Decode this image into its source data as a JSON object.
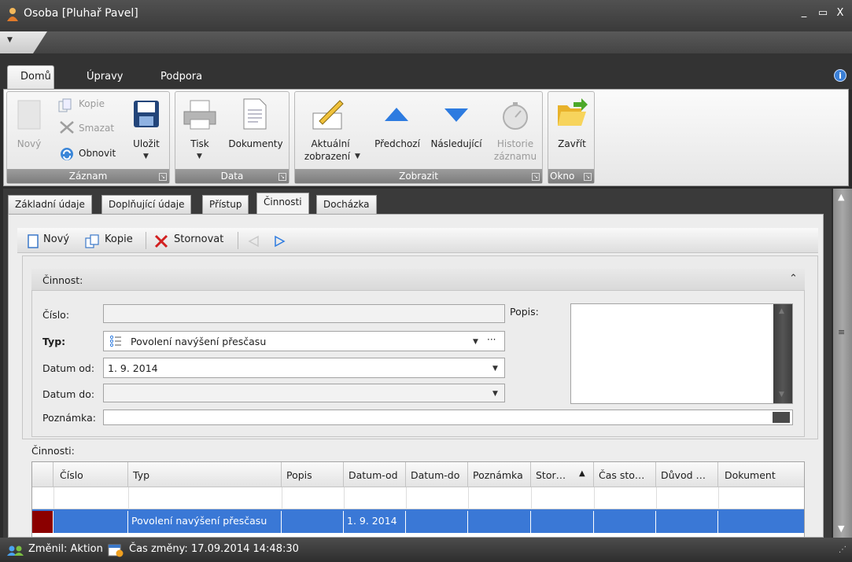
{
  "window": {
    "title": "Osoba [Pluhař Pavel]",
    "minimize": "_",
    "maximize": "▭",
    "close": "X"
  },
  "ribbon_tabs": [
    "Domů",
    "Úpravy",
    "Podpora"
  ],
  "ribbon": {
    "zaznam": {
      "label": "Záznam",
      "novy": "Nový",
      "kopie": "Kopie",
      "smazat": "Smazat",
      "obnovit": "Obnovit",
      "ulozit": "Uložit"
    },
    "data": {
      "label": "Data",
      "tisk": "Tisk",
      "dokumenty": "Dokumenty"
    },
    "zobrazit": {
      "label": "Zobrazit",
      "aktualni1": "Aktuální",
      "aktualni2": "zobrazení",
      "predchozi": "Předchozí",
      "nasledujici": "Následující",
      "historie1": "Historie",
      "historie2": "záznamu"
    },
    "okno": {
      "label": "Okno",
      "zavrit": "Zavřít"
    }
  },
  "doc_tabs": [
    "Základní údaje",
    "Doplňující údaje",
    "Přístup",
    "Činnosti",
    "Docházka"
  ],
  "toolbar": {
    "novy": "Nový",
    "kopie": "Kopie",
    "stornovat": "Stornovat"
  },
  "section": {
    "title": "Činnost:"
  },
  "form": {
    "cislo_label": "Číslo:",
    "cislo_value": "",
    "typ_label": "Typ:",
    "typ_value": "Povolení navýšení přesčasu",
    "datum_od_label": "Datum od:",
    "datum_od_value": "1. 9. 2014",
    "datum_do_label": "Datum do:",
    "datum_do_value": "",
    "poznamka_label": "Poznámka:",
    "poznamka_value": "",
    "popis_label": "Popis:"
  },
  "grid": {
    "caption": "Činnosti:",
    "columns": [
      "Číslo",
      "Typ",
      "Popis",
      "Datum-od",
      "Datum-do",
      "Poznámka",
      "Stor…",
      "Čas sto…",
      "Důvod …",
      "Dokument"
    ],
    "sort_indicator": "▲",
    "rows": [
      {
        "cislo": "",
        "typ": "Povolení navýšení přesčasu",
        "popis": "",
        "datum_od": "1. 9. 2014",
        "datum_do": "",
        "poznamka": ""
      }
    ]
  },
  "status": {
    "zmenil": "Změnil: Aktion",
    "cas_zmeny": "Čas změny: 17.09.2014 14:48:30"
  },
  "colors": {
    "selection": "#3a78d6",
    "row_marker": "#8b0000",
    "accent_blue": "#2d7be0"
  }
}
